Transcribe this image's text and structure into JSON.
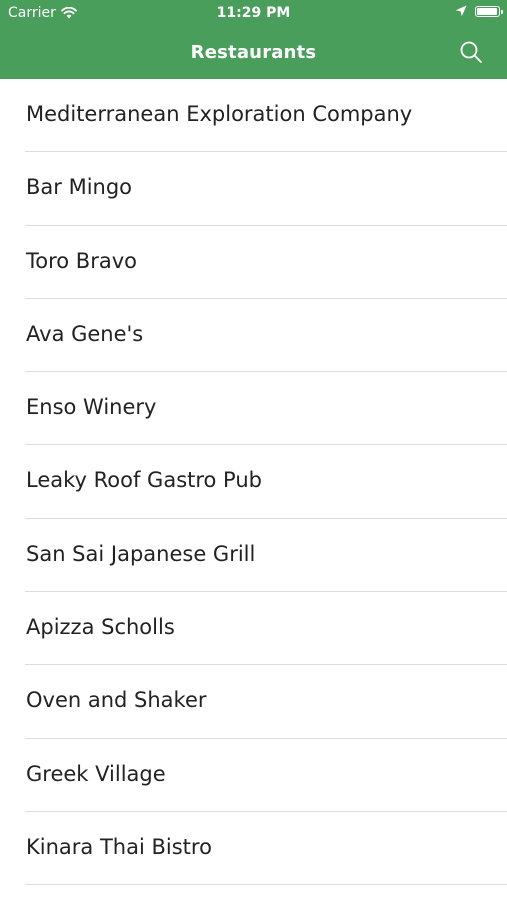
{
  "status_bar": {
    "carrier": "Carrier",
    "time": "11:29 PM",
    "battery_level": 0.95
  },
  "nav": {
    "title": "Restaurants",
    "search_icon": "search-icon"
  },
  "colors": {
    "header_background": "#4a9e5c",
    "header_text": "#ffffff",
    "row_text": "#222222",
    "separator": "#dcdcdc"
  },
  "restaurants": [
    "Mediterranean Exploration Company",
    "Bar Mingo",
    "Toro Bravo",
    "Ava Gene's",
    "Enso Winery",
    "Leaky Roof Gastro Pub",
    "San Sai Japanese Grill",
    "Apizza Scholls",
    "Oven and Shaker",
    "Greek Village",
    "Kinara Thai Bistro"
  ]
}
